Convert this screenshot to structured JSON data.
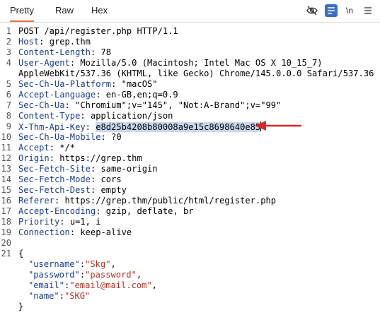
{
  "tabs": [
    {
      "label": "Pretty",
      "active": true
    },
    {
      "label": "Raw",
      "active": false
    },
    {
      "label": "Hex",
      "active": false
    }
  ],
  "tools": {
    "hide_icon": "eye-slash-icon",
    "wrap_icon": "list-icon",
    "newline_label": "\\n",
    "menu_icon": "hamburger-icon",
    "accent": "#3b6fc4"
  },
  "lines": [
    {
      "n": "1",
      "key": "",
      "sep": "",
      "value": "POST /api/register.php HTTP/1.1"
    },
    {
      "n": "2",
      "key": "Host",
      "sep": ": ",
      "value": "grep.thm"
    },
    {
      "n": "3",
      "key": "Content-Length",
      "sep": ": ",
      "value": "78"
    },
    {
      "n": "4",
      "key": "User-Agent",
      "sep": ": ",
      "value": "Mozilla/5.0 (Macintosh; Intel Mac OS X 10_15_7)"
    },
    {
      "n": "",
      "key": "",
      "sep": "",
      "value": "AppleWebKit/537.36 (KHTML, like Gecko) Chrome/145.0.0.0 Safari/537.36"
    },
    {
      "n": "5",
      "key": "Sec-Ch-Ua-Platform",
      "sep": ": ",
      "value": "\"macOS\""
    },
    {
      "n": "6",
      "key": "Accept-Language",
      "sep": ": ",
      "value": "en-GB,en;q=0.9"
    },
    {
      "n": "7",
      "key": "Sec-Ch-Ua",
      "sep": ": ",
      "value": "\"Chromium\";v=\"145\", \"Not:A-Brand\";v=\"99\""
    },
    {
      "n": "8",
      "key": "Content-Type",
      "sep": ": ",
      "value": "application/json"
    },
    {
      "n": "9",
      "key": "X-Thm-Api-Key",
      "sep": ": ",
      "value": "e8d25b4208b80008a9e15c8698640e85",
      "selected": true
    },
    {
      "n": "10",
      "key": "Sec-Ch-Ua-Mobile",
      "sep": ": ",
      "value": "?0"
    },
    {
      "n": "11",
      "key": "Accept",
      "sep": ": ",
      "value": "*/*"
    },
    {
      "n": "12",
      "key": "Origin",
      "sep": ": ",
      "value": "https://grep.thm"
    },
    {
      "n": "13",
      "key": "Sec-Fetch-Site",
      "sep": ": ",
      "value": "same-origin"
    },
    {
      "n": "14",
      "key": "Sec-Fetch-Mode",
      "sep": ": ",
      "value": "cors"
    },
    {
      "n": "15",
      "key": "Sec-Fetch-Dest",
      "sep": ": ",
      "value": "empty"
    },
    {
      "n": "16",
      "key": "Referer",
      "sep": ": ",
      "value": "https://grep.thm/public/html/register.php"
    },
    {
      "n": "17",
      "key": "Accept-Encoding",
      "sep": ": ",
      "value": "gzip, deflate, br"
    },
    {
      "n": "18",
      "key": "Priority",
      "sep": ": ",
      "value": "u=1, i"
    },
    {
      "n": "19",
      "key": "Connection",
      "sep": ": ",
      "value": "keep-alive"
    },
    {
      "n": "20",
      "key": "",
      "sep": "",
      "value": ""
    },
    {
      "n": "21",
      "key": "",
      "sep": "",
      "value": "{"
    },
    {
      "n": "",
      "json": true,
      "jkey": "\"username\"",
      "jval": "\"Skg\"",
      "trail": ","
    },
    {
      "n": "",
      "json": true,
      "jkey": "\"password\"",
      "jval": "\"password\"",
      "trail": ","
    },
    {
      "n": "",
      "json": true,
      "jkey": "\"email\"",
      "jval": "\"email@mail.com\"",
      "trail": ","
    },
    {
      "n": "",
      "json": true,
      "jkey": "\"name\"",
      "jval": "\"SKG\"",
      "trail": ""
    },
    {
      "n": "",
      "key": "",
      "sep": "",
      "value": "}"
    }
  ],
  "annotation": {
    "arrow_color": "#d9262b"
  }
}
